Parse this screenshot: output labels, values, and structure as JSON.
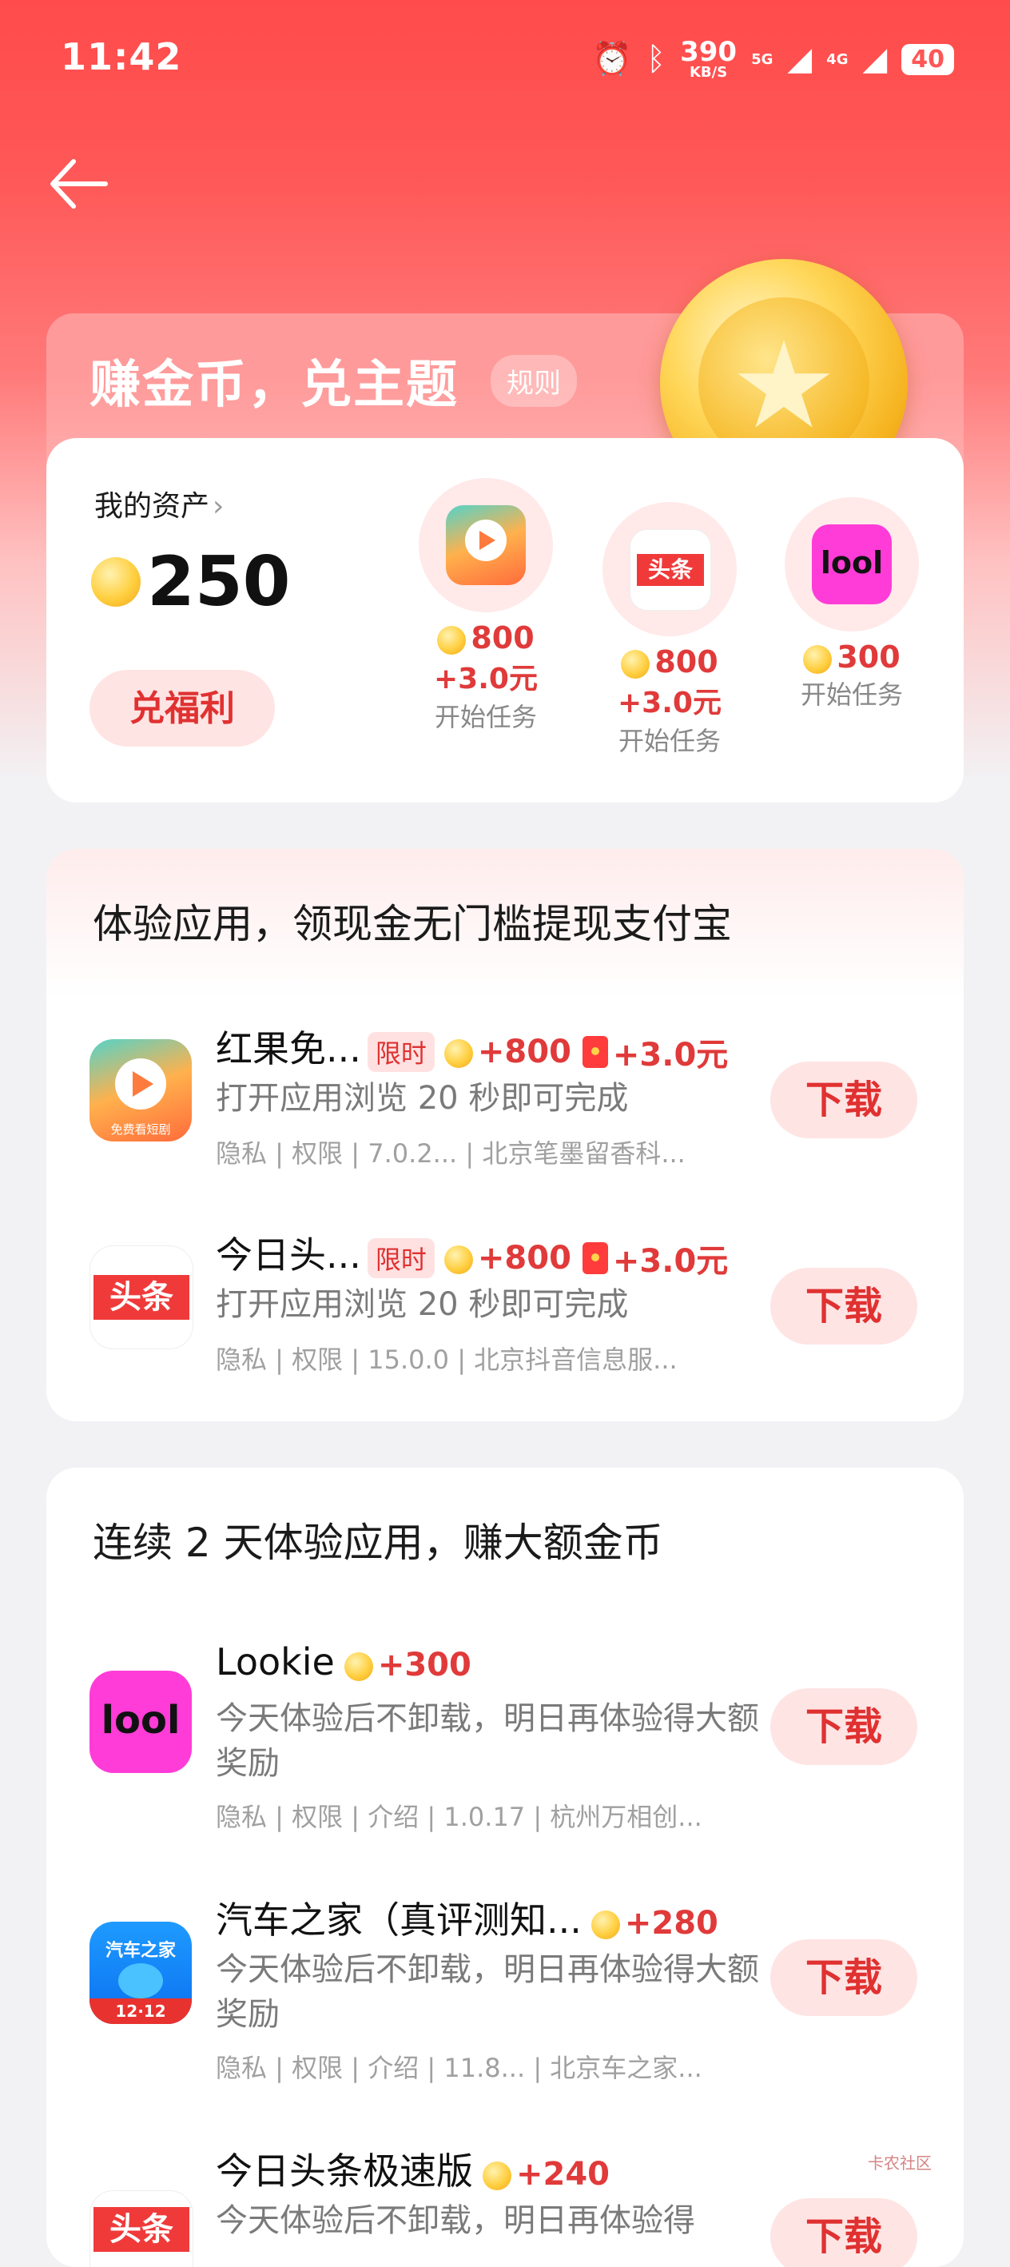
{
  "status_bar": {
    "time": "11:42",
    "net_speed": "390",
    "net_unit": "KB/S",
    "net1": "5G",
    "net2": "4G",
    "battery": "40"
  },
  "header": {
    "title": "赚金币，兑主题",
    "rule": "规则"
  },
  "assets": {
    "label": "我的资产",
    "amount": "250",
    "redeem": "兑福利",
    "tasks": [
      {
        "points": "800",
        "cash": "+3.0元",
        "action": "开始任务",
        "icon": "hongguo-icon"
      },
      {
        "points": "800",
        "cash": "+3.0元",
        "action": "开始任务",
        "icon": "toutiao-icon"
      },
      {
        "points": "300",
        "action": "开始任务",
        "icon": "lookie-icon"
      }
    ]
  },
  "section1": {
    "title": "体验应用，领现金无门槛提现支付宝",
    "items": [
      {
        "name": "红果免...",
        "limited": "限时",
        "points": "+800",
        "cash": "+3.0元",
        "desc": "打开应用浏览 20 秒即可完成",
        "meta": "隐私 | 权限 | 7.0.2...  | 北京笔墨留香科...",
        "button": "下载"
      },
      {
        "name": "今日头...",
        "limited": "限时",
        "points": "+800",
        "cash": "+3.0元",
        "desc": "打开应用浏览 20 秒即可完成",
        "meta": "隐私 | 权限 | 15.0.0  | 北京抖音信息服...",
        "button": "下载"
      }
    ]
  },
  "section2": {
    "title": "连续 2 天体验应用，赚大额金币",
    "items": [
      {
        "name": "Lookie",
        "points": "+300",
        "desc": "今天体验后不卸载，明日再体验得大额奖励",
        "meta": "隐私 | 权限 | 介绍 | 1.0.17  | 杭州万相创...",
        "button": "下载"
      },
      {
        "name": "汽车之家（真评测知...",
        "points": "+280",
        "desc": "今天体验后不卸载，明日再体验得大额奖励",
        "meta": "隐私 | 权限 | 介绍 | 11.8...  | 北京车之家...",
        "button": "下载"
      },
      {
        "name": "今日头条极速版",
        "points": "+240",
        "desc": "今天体验后不卸载，明日再体验得",
        "button": "下载"
      }
    ]
  },
  "icon_text": {
    "toutiao": "头条",
    "lookie": "lool",
    "qiche": "汽车之家",
    "qiche_badge": "12·12",
    "hongguo_badge": "免费看短剧"
  },
  "watermark": "卡农社区",
  "colors": {
    "accent": "#e03131",
    "hero": "#ff4b4b",
    "chip": "#ffe4e4"
  }
}
